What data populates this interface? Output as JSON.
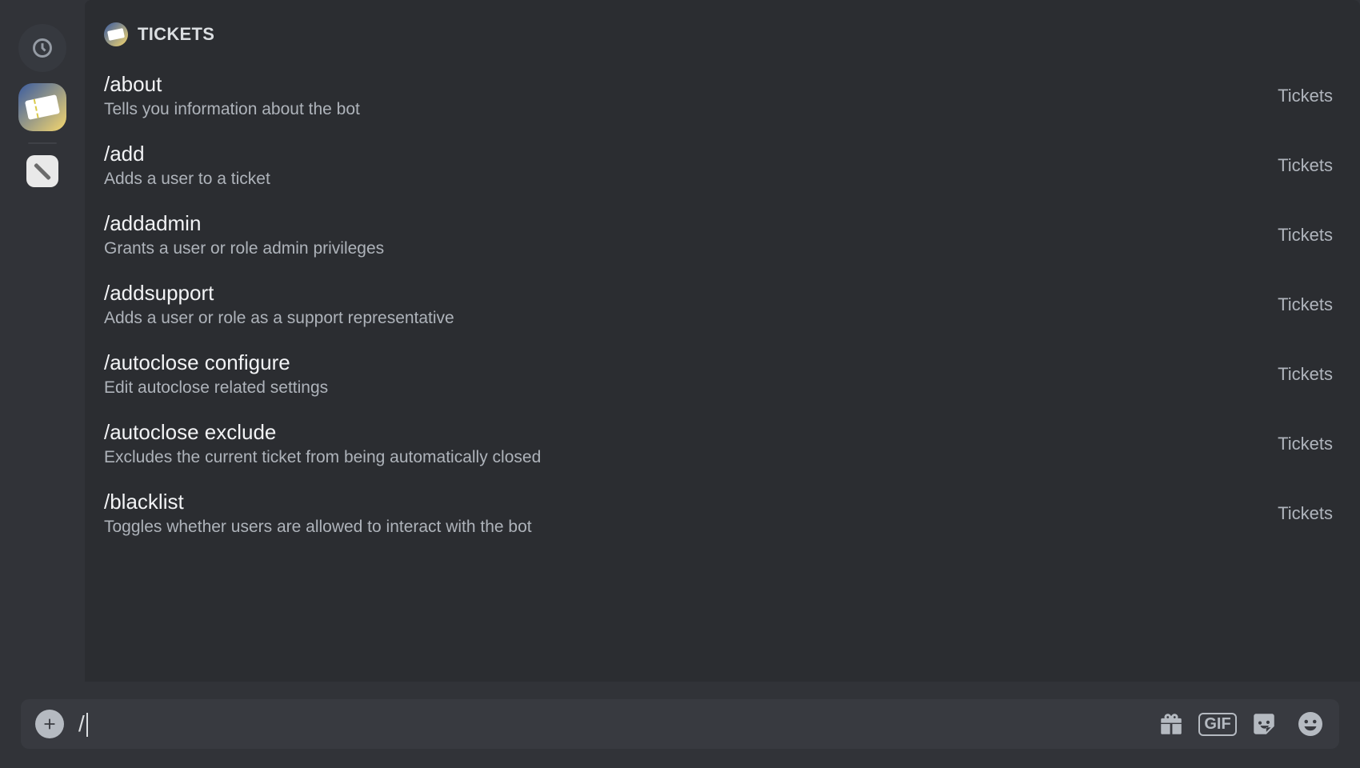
{
  "sidebar": {
    "history_icon": "clock-icon",
    "ticket_server": "tickets-server-icon",
    "square_icon": "slash-icon"
  },
  "popup": {
    "header_label": "TICKETS",
    "source_label": "Tickets",
    "commands": [
      {
        "name": "/about",
        "desc": "Tells you information about the bot"
      },
      {
        "name": "/add",
        "desc": "Adds a user to a ticket"
      },
      {
        "name": "/addadmin",
        "desc": "Grants a user or role admin privileges"
      },
      {
        "name": "/addsupport",
        "desc": "Adds a user or role as a support representative"
      },
      {
        "name": "/autoclose configure",
        "desc": "Edit autoclose related settings"
      },
      {
        "name": "/autoclose exclude",
        "desc": "Excludes the current ticket from being automatically closed"
      },
      {
        "name": "/blacklist",
        "desc": "Toggles whether users are allowed to interact with the bot"
      }
    ]
  },
  "input": {
    "value": "/",
    "gif_label": "GIF"
  }
}
